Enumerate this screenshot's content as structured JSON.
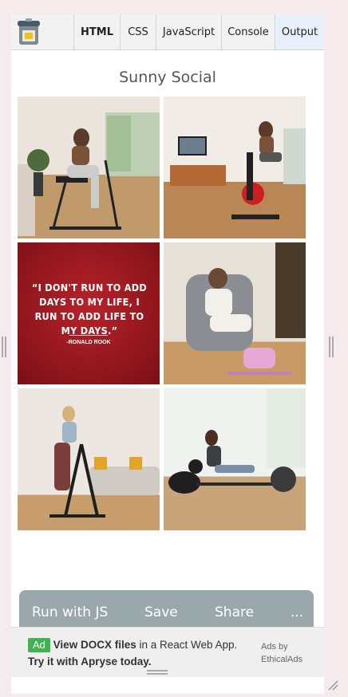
{
  "tabs": {
    "html": "HTML",
    "css": "CSS",
    "javascript": "JavaScript",
    "console": "Console",
    "output": "Output"
  },
  "page": {
    "title": "Sunny Social"
  },
  "gallery": {
    "quote": "“I DON'T RUN TO ADD DAYS TO MY LIFE, I RUN TO ADD LIFE TO MY DAYS.”",
    "quote_author": "-RONALD ROOK"
  },
  "toolbar": {
    "run": "Run with JS",
    "save": "Save",
    "share": "Share",
    "more": "..."
  },
  "ad": {
    "badge": "Ad",
    "headline_bold": "View DOCX files",
    "headline_rest": " in a React Web App.",
    "cta": "Try it with Apryse today.",
    "by": "Ads by EthicalAds"
  },
  "colors": {
    "background": "#f6ebec",
    "toolbar": "#9aa8ab",
    "ad_badge": "#3fb34f",
    "active_tab": "#e8f0fb"
  }
}
